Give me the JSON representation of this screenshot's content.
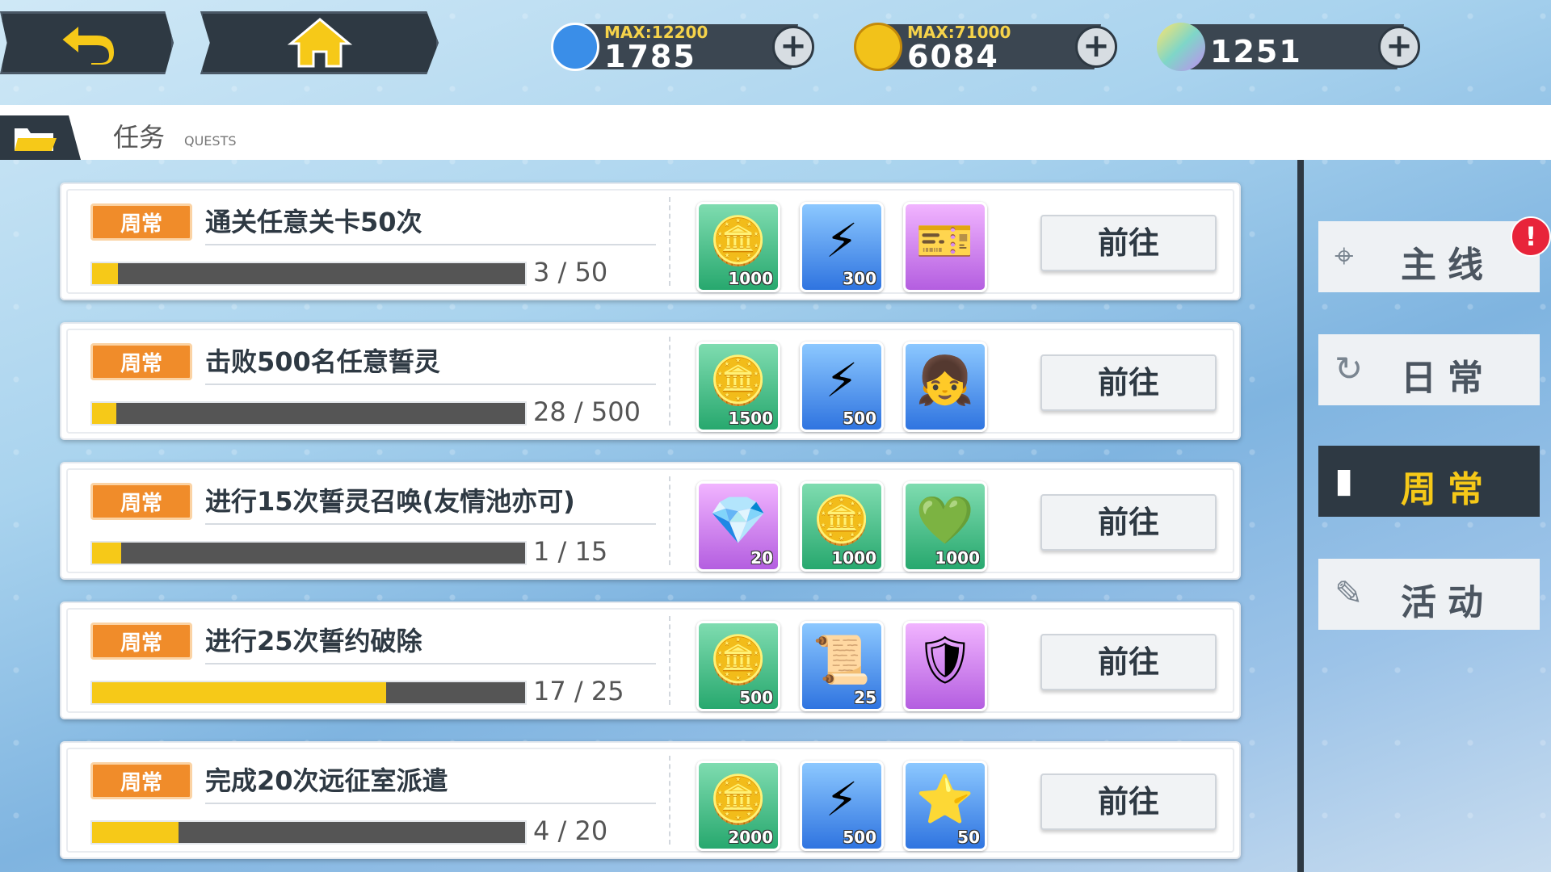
{
  "topbar": {
    "back_icon": "back-arrow-icon",
    "home_icon": "home-icon",
    "resources": [
      {
        "icon": "battery-icon",
        "max": "MAX:12200",
        "value": "1785",
        "color": "#3a8ee8"
      },
      {
        "icon": "gold-coin-icon",
        "max": "MAX:71000",
        "value": "6084",
        "color": "#f2c21a"
      },
      {
        "icon": "crystal-icon",
        "max": "",
        "value": "1251",
        "color": "#7fd6c8"
      }
    ],
    "plus_label": "+"
  },
  "header": {
    "title": "任务",
    "subtitle": "QUESTS"
  },
  "quests": [
    {
      "tag": "周常",
      "name": "通关任意关卡50次",
      "current": "3",
      "total": "50",
      "progress": 0.06,
      "progress_text": "3 / 50",
      "rewards": [
        {
          "type": "gold-coin-icon",
          "bg": "green",
          "count": "1000"
        },
        {
          "type": "battery-icon",
          "bg": "blue",
          "count": "300"
        },
        {
          "type": "card-icon",
          "bg": "purple",
          "count": ""
        }
      ],
      "button": "前往"
    },
    {
      "tag": "周常",
      "name": "击败500名任意誓灵",
      "current": "28",
      "total": "500",
      "progress": 0.056,
      "progress_text": "28 / 500",
      "rewards": [
        {
          "type": "gold-coin-icon",
          "bg": "green",
          "count": "1500"
        },
        {
          "type": "battery-icon",
          "bg": "blue",
          "count": "500"
        },
        {
          "type": "character-portrait-icon",
          "bg": "blue",
          "count": ""
        }
      ],
      "button": "前往"
    },
    {
      "tag": "周常",
      "name": "进行15次誓灵召唤(友情池亦可)",
      "current": "1",
      "total": "15",
      "progress": 0.067,
      "progress_text": "1 / 15",
      "rewards": [
        {
          "type": "crystal-icon",
          "bg": "purple",
          "count": "20"
        },
        {
          "type": "gold-coin-icon",
          "bg": "green",
          "count": "1000"
        },
        {
          "type": "heart-coin-icon",
          "bg": "green",
          "count": "1000"
        }
      ],
      "button": "前往"
    },
    {
      "tag": "周常",
      "name": "进行25次誓约破除",
      "current": "17",
      "total": "25",
      "progress": 0.68,
      "progress_text": "17 / 25",
      "rewards": [
        {
          "type": "gold-coin-icon",
          "bg": "green",
          "count": "500"
        },
        {
          "type": "scroll-icon",
          "bg": "blue",
          "count": "25"
        },
        {
          "type": "armor-chest-icon",
          "bg": "purple",
          "count": ""
        }
      ],
      "button": "前往"
    },
    {
      "tag": "周常",
      "name": "完成20次远征室派遣",
      "current": "4",
      "total": "20",
      "progress": 0.2,
      "progress_text": "4 / 20",
      "rewards": [
        {
          "type": "gold-coin-icon",
          "bg": "green",
          "count": "2000"
        },
        {
          "type": "battery-icon",
          "bg": "blue",
          "count": "500"
        },
        {
          "type": "star-coin-icon",
          "bg": "blue",
          "count": "50"
        }
      ],
      "button": "前往"
    }
  ],
  "tabs": [
    {
      "label": "主线",
      "icon": "map-pin-icon",
      "active": false
    },
    {
      "label": "日常",
      "icon": "refresh-icon",
      "active": false
    },
    {
      "label": "周常",
      "icon": "bar-chart-icon",
      "active": true
    },
    {
      "label": "活动",
      "icon": "wrench-icon",
      "active": false
    }
  ],
  "alert_badge": "!"
}
